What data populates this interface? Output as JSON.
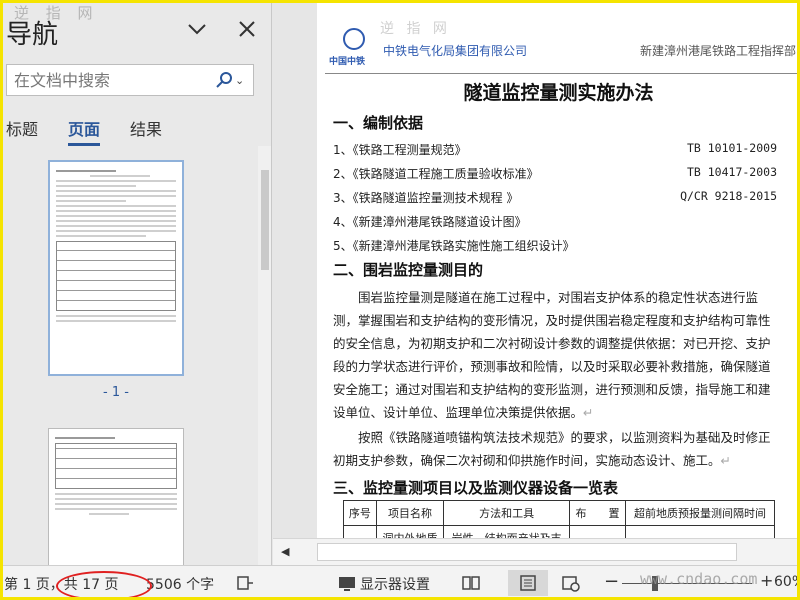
{
  "watermark_top_left": "逆 指 网",
  "watermark_bottom_right": "www.cndao.com",
  "nav": {
    "title": "导航",
    "search_placeholder": "在文档中搜索",
    "tabs": [
      {
        "label": "标题",
        "active": false
      },
      {
        "label": "页面",
        "active": true
      },
      {
        "label": "结果",
        "active": false
      }
    ],
    "thumb_label": "- 1 -"
  },
  "document": {
    "company": "中铁电气化局集团有限公司",
    "logo_text": "中国中铁",
    "header_right": "新建漳州港尾铁路工程指挥部",
    "title": "隧道监控量测实施办法",
    "section1": "一、编制依据",
    "refs": [
      {
        "name": "1、《铁路工程测量规范》",
        "code": "TB 10101-2009"
      },
      {
        "name": "2、《铁路隧道工程施工质量验收标准》",
        "code": "TB 10417-2003"
      },
      {
        "name": "3、《铁路隧道监控量测技术规程 》",
        "code": "Q/CR 9218-2015"
      },
      {
        "name": "4、《新建漳州港尾铁路隧道设计图》",
        "code": ""
      },
      {
        "name": "5、《新建漳州港尾铁路实施性施工组织设计》",
        "code": ""
      }
    ],
    "section2": "二、围岩监控量测目的",
    "para1": "围岩监控量测是隧道在施工过程中，对围岩支护体系的稳定性状态进行监测，掌握围岩和支护结构的变形情况，及时提供围岩稳定程度和支护结构可靠性的安全信息，为初期支护和二次衬砌设计参数的调整提供依据：对已开挖、支护段的力学状态进行评价，预测事故和险情，以及时采取必要补救措施，确保隧道安全施工；通过对围岩和支护结构的变形监测，进行预测和反馈，指导施工和建设单位、设计单位、监理单位决策提供依据。",
    "para2": "按照《铁路隧道喷锚构筑法技术规范》的要求，以监测资料为基础及时修正初期支护参数，确保二次衬砌和仰拱施作时间，实施动态设计、施工。",
    "section3": "三、监控量测项目以及监测仪器设备一览表",
    "table_headers": [
      "序号",
      "项目名称",
      "方法和工具",
      "布　　置",
      "超前地质预报量测间隔时间"
    ],
    "table_row": [
      "",
      "洞内外地质",
      "岩性、结构面产状及支",
      "",
      ""
    ],
    "para_mark": "↵"
  },
  "status": {
    "page": "第 1 页，共 17 页",
    "words": "5506 个字",
    "display_settings": "显示器设置",
    "zoom": "60%"
  }
}
